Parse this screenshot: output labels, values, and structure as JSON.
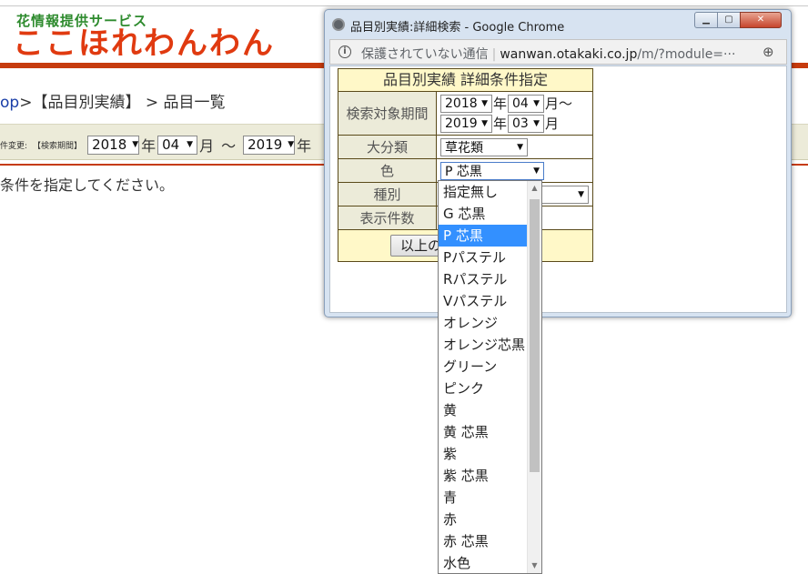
{
  "background": {
    "logo_sub": "花情報提供サービス",
    "logo_main": "ここほれわんわん",
    "breadcrumb": {
      "link": "op",
      "sep1": ">",
      "section": "【品目別実績】",
      "sep2": " > ",
      "current": "品目一覧"
    },
    "condition": {
      "prefix": "件変更:",
      "period_label": "【検索期間】",
      "from_year": "2018",
      "year_unit": "年",
      "from_month": "04",
      "month_unit": "月",
      "tilde": "～",
      "to_year": "2019",
      "to_year_unit": "年"
    },
    "message": "条件を指定してください。"
  },
  "popup": {
    "window_title": "品目別実績:詳細検索 - Google Chrome",
    "address": {
      "security": "保護されていない通信",
      "separator": "|",
      "domain": "wanwan.otakaki.co.jp",
      "path": "/m/?module=···"
    },
    "form": {
      "title": "品目別実績 詳細条件指定",
      "period": {
        "label": "検索対象期間",
        "from_year": "2018",
        "from_month": "04",
        "to_year": "2019",
        "to_month": "03",
        "year_unit": "年",
        "month_unit": "月",
        "range_mark": "月～"
      },
      "category": {
        "label": "大分類",
        "value": "草花類"
      },
      "color": {
        "label": "色",
        "value": "P 芯黒"
      },
      "type": {
        "label": "種別"
      },
      "count": {
        "label": "表示件数"
      },
      "submit_label": "以上の"
    }
  },
  "color_dropdown": {
    "options": [
      "指定無し",
      "G 芯黒",
      "P 芯黒",
      "Pパステル",
      "Rパステル",
      "Vパステル",
      "オレンジ",
      "オレンジ芯黒",
      "グリーン",
      "ピンク",
      "黄",
      "黄 芯黒",
      "紫",
      "紫 芯黒",
      "青",
      "赤",
      "赤 芯黒",
      "水色"
    ],
    "selected_index": 2,
    "accent": "#3390ff"
  },
  "colors": {
    "brand_red": "#e03a10",
    "brand_green": "#2e8b2e",
    "form_header_bg": "#fff8c8",
    "form_label_bg": "#ecebd9"
  }
}
